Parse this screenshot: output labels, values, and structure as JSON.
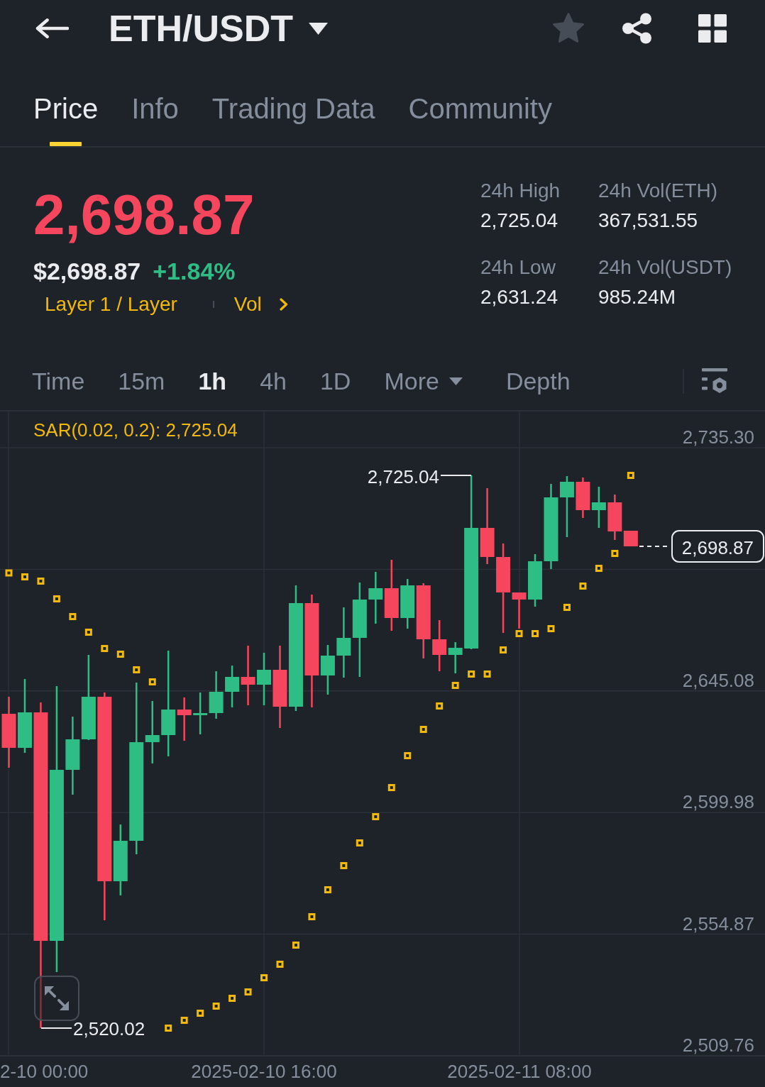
{
  "header": {
    "title": "ETH/USDT",
    "starred": false
  },
  "tabs": [
    {
      "label": "Price",
      "selected": true
    },
    {
      "label": "Info",
      "selected": false
    },
    {
      "label": "Trading Data",
      "selected": false
    },
    {
      "label": "Community",
      "selected": false
    }
  ],
  "ticker": {
    "price": "2,698.87",
    "price_falling": true,
    "fiat_price": "$2,698.87",
    "change": "+1.84%",
    "change_rising": true,
    "tags": [
      "Layer 1 / Layer",
      "Vol"
    ]
  },
  "stats": [
    {
      "label": "24h High",
      "value": "2,725.04"
    },
    {
      "label": "24h Vol(ETH)",
      "value": "367,531.55"
    },
    {
      "label": "24h Low",
      "value": "2,631.24"
    },
    {
      "label": "24h Vol(USDT)",
      "value": "985.24M"
    }
  ],
  "intervals": [
    {
      "label": "Time",
      "selected": false
    },
    {
      "label": "15m",
      "selected": false
    },
    {
      "label": "1h",
      "selected": true
    },
    {
      "label": "4h",
      "selected": false
    },
    {
      "label": "1D",
      "selected": false
    }
  ],
  "more_menu": {
    "label": "More"
  },
  "depth_tab": {
    "label": "Depth",
    "selected": false
  },
  "chart": {
    "indicator": "SAR(0.02, 0.2): 2,725.04",
    "price_axis": [
      "2,735.30",
      "2,645.08",
      "2,599.98",
      "2,554.87",
      "2,509.76"
    ],
    "time_axis": [
      "2-10 00:00",
      "2025-02-10 16:00",
      "2025-02-11 08:00"
    ],
    "high_label": "2,725.04",
    "low_label": "2,520.02",
    "last_price_tag": "2,698.87"
  }
}
